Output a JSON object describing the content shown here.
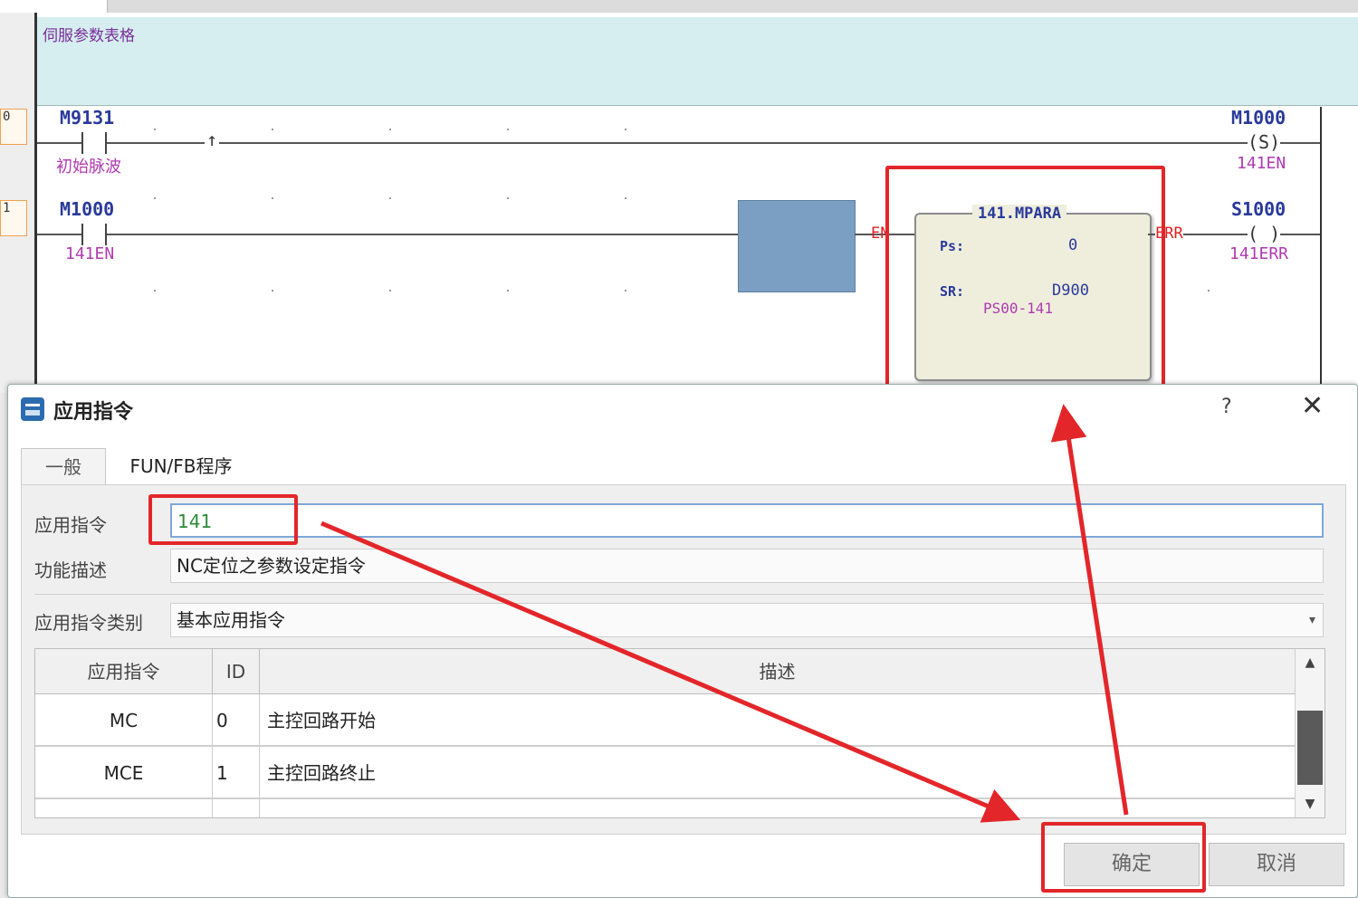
{
  "ladder": {
    "comment": "伺服参数表格",
    "step_numbers": [
      "0",
      "1"
    ],
    "rung1": {
      "contact_label": "M9131",
      "contact_comment": "初始脉波",
      "edge_symbol": "↑",
      "coil_label": "M1000",
      "coil_symbol": "(S)",
      "coil_comment": "141EN"
    },
    "rung2": {
      "contact_label": "M1000",
      "contact_comment": "141EN",
      "fb_title": "141.MPARA",
      "en_pin": "EN",
      "err_pin": "ERR",
      "ps_label": "Ps:",
      "ps_value": "0",
      "sr_label": "SR:",
      "sr_value": "D900",
      "sr_comment": "PS00-141",
      "coil_label": "S1000",
      "coil_symbol": "( )",
      "coil_comment": "141ERR"
    }
  },
  "dialog": {
    "title": "应用指令",
    "help": "?",
    "close": "✕",
    "tabs": [
      "一般",
      "FUN/FB程序"
    ],
    "fields": {
      "instruction_label": "应用指令",
      "instruction_value": "141",
      "description_label": "功能描述",
      "description_value": "NC定位之参数设定指令",
      "category_label": "应用指令类别",
      "category_value": "基本应用指令"
    },
    "table": {
      "headers": [
        "应用指令",
        "ID",
        "描述"
      ],
      "rows": [
        {
          "instruction": "MC",
          "id": "0",
          "description": "主控回路开始"
        },
        {
          "instruction": "MCE",
          "id": "1",
          "description": "主控回路终止"
        }
      ]
    },
    "buttons": {
      "ok": "确定",
      "cancel": "取消"
    }
  },
  "colors": {
    "annotation_red": "#e3262a",
    "label_blue": "#2a3a9a",
    "comment_purple": "#b03ab0",
    "comment_bg": "#d6eef0"
  }
}
